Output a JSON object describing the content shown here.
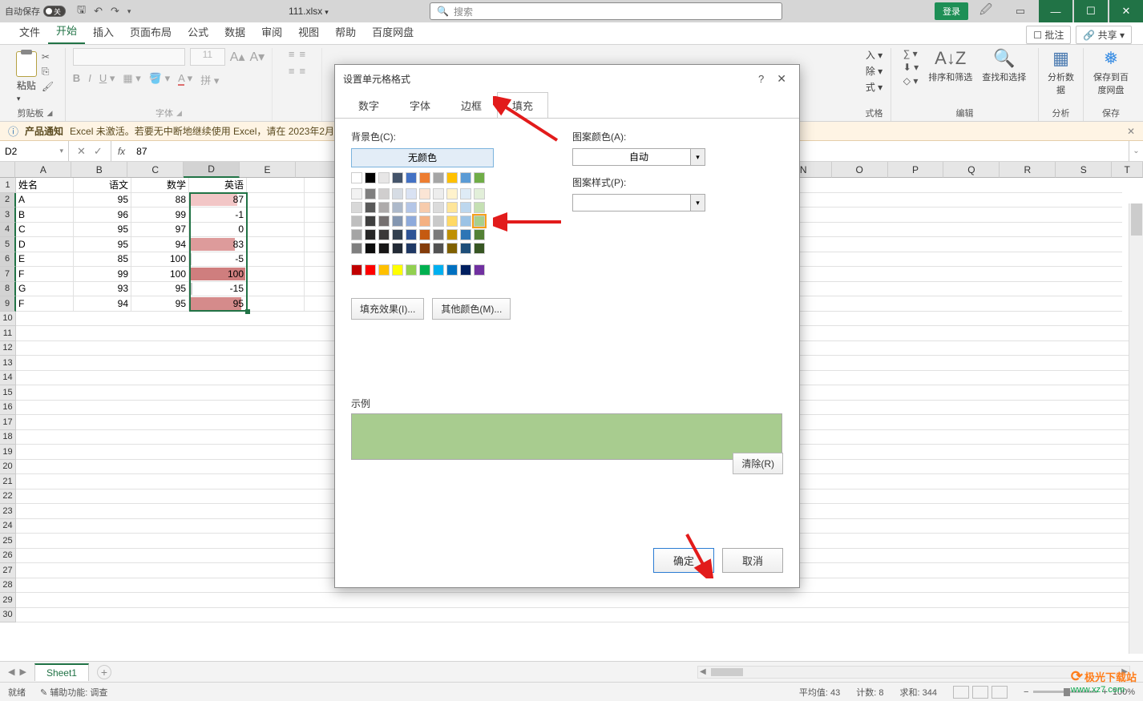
{
  "titlebar": {
    "auto_save": "自动保存",
    "toggle_state": "关",
    "filename": "111.xlsx",
    "search_placeholder": "搜索",
    "login": "登录"
  },
  "ribbon_tabs": [
    "文件",
    "开始",
    "插入",
    "页面布局",
    "公式",
    "数据",
    "审阅",
    "视图",
    "帮助",
    "百度网盘"
  ],
  "ribbon_tabs_active": 1,
  "ribbon_right": {
    "comment": "批注",
    "share": "共享"
  },
  "ribbon": {
    "paste": "粘贴",
    "clipboard": "剪贴板",
    "font_group": "字体",
    "font_size": "11",
    "cells": {
      "insert": "插入",
      "delete": "删除",
      "format": "格式",
      "label": "式格"
    },
    "edit": {
      "sort_filter": "排序和筛选",
      "find_select": "查找和选择",
      "label": "编辑"
    },
    "analysis": {
      "btn": "分析数据",
      "label": "分析"
    },
    "save": {
      "btn": "保存到百度网盘",
      "label": "保存"
    }
  },
  "warning": {
    "title": "产品通知",
    "text": "Excel 未激活。若要无中断地继续使用 Excel，请在 2023年2月"
  },
  "formula_bar": {
    "namebox": "D2",
    "value": "87"
  },
  "columns": [
    "A",
    "B",
    "C",
    "D",
    "E",
    "N",
    "O",
    "P",
    "Q",
    "R",
    "S",
    "T"
  ],
  "col_widths": {
    "default": 72,
    "row_header": 20
  },
  "selected_col": "D",
  "selected_rows": [
    2,
    3,
    4,
    5,
    6,
    7,
    8,
    9
  ],
  "rows": [
    {
      "n": 1,
      "cells": [
        "姓名",
        "语文",
        "数学",
        "英语"
      ]
    },
    {
      "n": 2,
      "cells": [
        "A",
        "95",
        "88",
        "87"
      ],
      "bar": {
        "color": "#f2c6c6",
        "pct": 0.84
      }
    },
    {
      "n": 3,
      "cells": [
        "B",
        "96",
        "99",
        "-1"
      ],
      "bar": {
        "color": "#cdcdcd",
        "pct": 0.05,
        "neg": true
      }
    },
    {
      "n": 4,
      "cells": [
        "C",
        "95",
        "97",
        "0"
      ],
      "bar": {
        "color": "#cdcdcd",
        "pct": 0.02,
        "neg": true
      }
    },
    {
      "n": 5,
      "cells": [
        "D",
        "95",
        "94",
        "83"
      ],
      "bar": {
        "color": "#dd9b9b",
        "pct": 0.8
      }
    },
    {
      "n": 6,
      "cells": [
        "E",
        "85",
        "100",
        "-5"
      ],
      "bar": {
        "color": "#cdcdcd",
        "pct": 0.08,
        "neg": true
      }
    },
    {
      "n": 7,
      "cells": [
        "F",
        "99",
        "100",
        "100"
      ],
      "bar": {
        "color": "#cf7e7e",
        "pct": 0.98
      }
    },
    {
      "n": 8,
      "cells": [
        "G",
        "93",
        "95",
        "-15"
      ],
      "bar": {
        "color": "#cdcdcd",
        "pct": 0.15,
        "neg": true
      }
    },
    {
      "n": 9,
      "cells": [
        "F",
        "94",
        "95",
        "95"
      ],
      "bar": {
        "color": "#d58b8b",
        "pct": 0.92
      }
    }
  ],
  "blank_rows": 21,
  "sheet": {
    "name": "Sheet1"
  },
  "status": {
    "ready": "就绪",
    "a11y": "辅助功能: 调查",
    "avg_label": "平均值:",
    "avg": "43",
    "count_label": "计数:",
    "count": "8",
    "sum_label": "求和:",
    "sum": "344",
    "zoom": "100%"
  },
  "dialog": {
    "title": "设置单元格格式",
    "tabs": [
      "数字",
      "字体",
      "边框",
      "填充"
    ],
    "active_tab": 3,
    "bg_color_label": "背景色(C):",
    "no_color": "无颜色",
    "pattern_color_label": "图案颜色(A):",
    "pattern_auto": "自动",
    "pattern_style_label": "图案样式(P):",
    "fill_effects": "填充效果(I)...",
    "more_colors": "其他颜色(M)...",
    "sample_label": "示例",
    "clear": "清除(R)",
    "ok": "确定",
    "cancel": "取消",
    "sample_color": "#a8cc8f",
    "palette_rows": [
      [
        "#ffffff",
        "#000000",
        "#e7e6e6",
        "#44546a",
        "#4472c4",
        "#ed7d31",
        "#a5a5a5",
        "#ffc000",
        "#5b9bd5",
        "#70ad47"
      ],
      [
        "#f2f2f2",
        "#7f7f7f",
        "#d0cece",
        "#d6dce4",
        "#d9e2f3",
        "#fbe5d5",
        "#ededed",
        "#fff2cc",
        "#deebf6",
        "#e2efd9"
      ],
      [
        "#d8d8d8",
        "#595959",
        "#aeabab",
        "#adb9ca",
        "#b4c6e7",
        "#f7cbac",
        "#dbdbdb",
        "#fee599",
        "#bdd7ee",
        "#c5e0b3"
      ],
      [
        "#bfbfbf",
        "#3f3f3f",
        "#757070",
        "#8496b0",
        "#8eaadb",
        "#f4b183",
        "#c9c9c9",
        "#ffd965",
        "#9cc3e5",
        "#a8d08d"
      ],
      [
        "#a5a5a5",
        "#262626",
        "#3a3838",
        "#323f4f",
        "#2f5496",
        "#c55a11",
        "#7b7b7b",
        "#bf9000",
        "#2e75b5",
        "#538135"
      ],
      [
        "#7f7f7f",
        "#0c0c0c",
        "#171616",
        "#222a35",
        "#1f3864",
        "#833c0b",
        "#525252",
        "#7f6000",
        "#1e4e79",
        "#375623"
      ]
    ],
    "standard_row": [
      "#c00000",
      "#ff0000",
      "#ffc000",
      "#ffff00",
      "#92d050",
      "#00b050",
      "#00b0f0",
      "#0070c0",
      "#002060",
      "#7030a0"
    ],
    "selected_swatch": [
      3,
      9
    ]
  },
  "watermark": {
    "brand": "极光下载站",
    "url": "www.xz7.com"
  }
}
